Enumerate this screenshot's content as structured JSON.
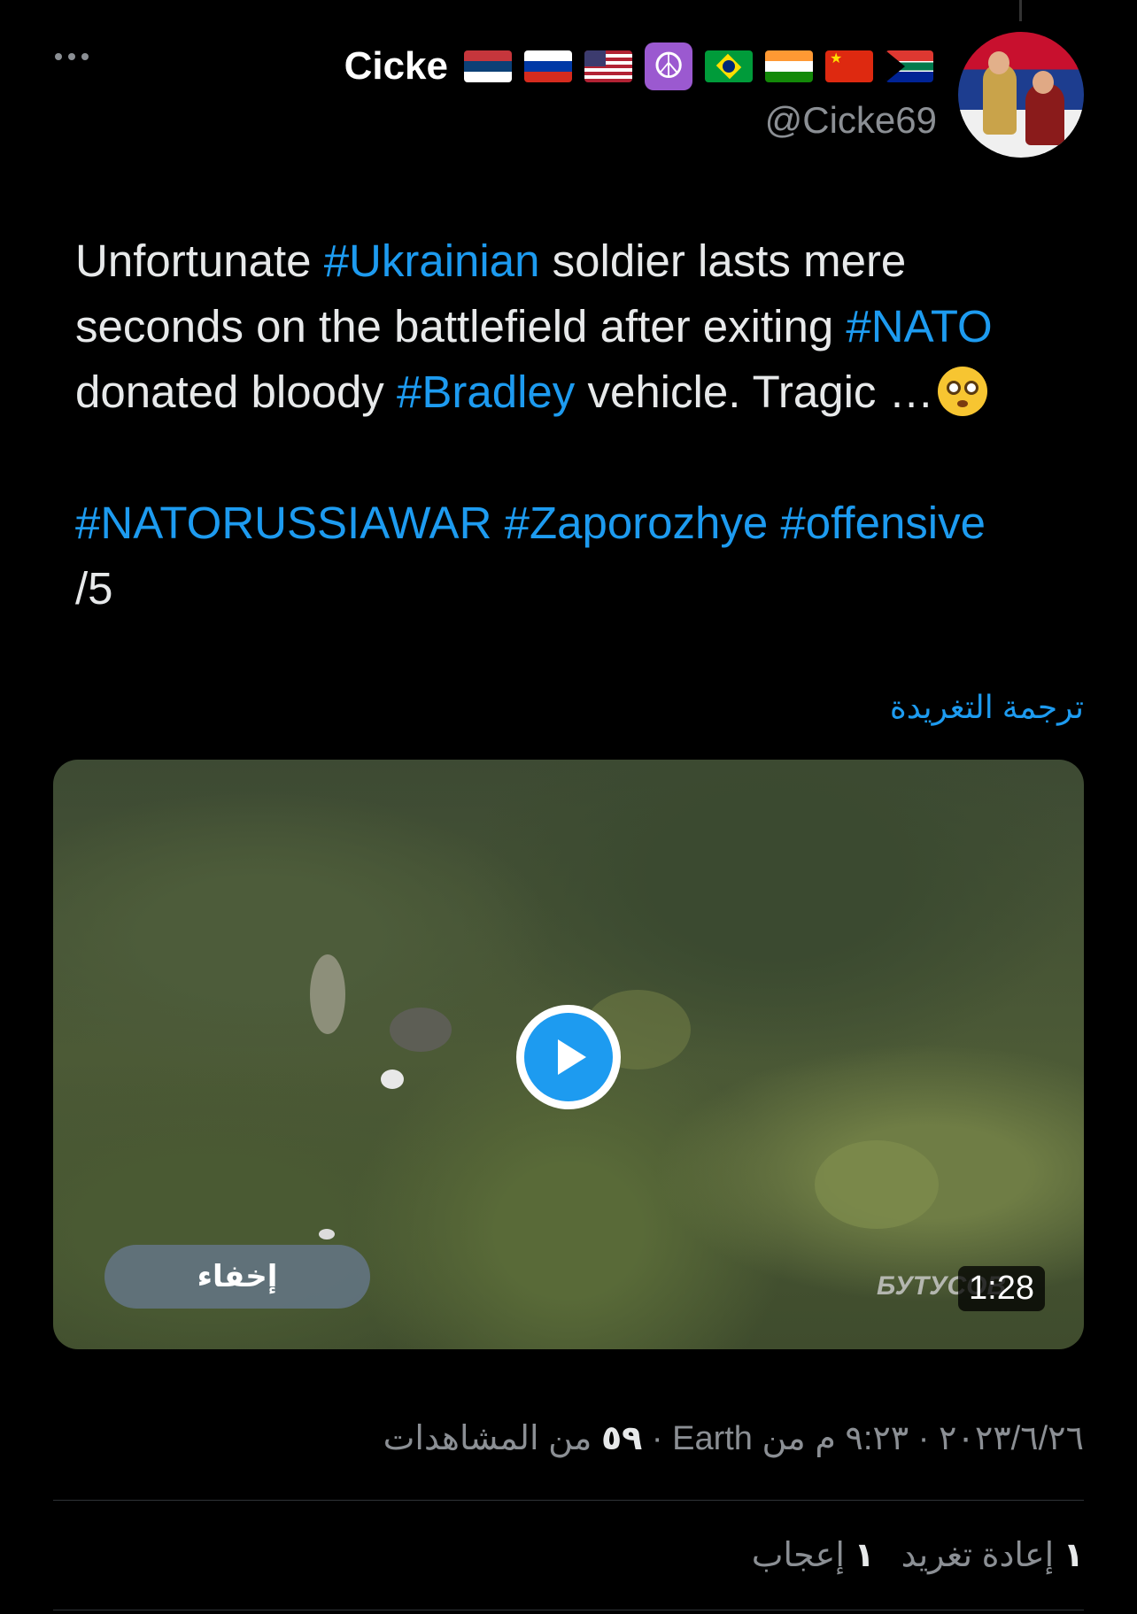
{
  "header": {
    "more_label": "•••",
    "display_name": "Cicke",
    "handle": "@Cicke69",
    "flags": [
      "serbia-flag",
      "russia-flag",
      "usa-flag",
      "peace-icon",
      "brazil-flag",
      "india-flag",
      "china-flag",
      "south-africa-flag"
    ]
  },
  "tweet": {
    "line1_a": "Unfortunate ",
    "tag_ukrainian": "#Ukrainian",
    "line1_b": " soldier lasts mere seconds on the battlefield after exiting ",
    "tag_nato": "#NATO",
    "line2_a": " donated bloody ",
    "tag_bradley": "#Bradley",
    "line2_b": " vehicle. Tragic …",
    "tag_natorussiawar": "#NATORUSSIAWAR",
    "tag_zaporozhye": "#Zaporozhye",
    "tag_offensive": "#offensive",
    "thread_index": "/5",
    "translate_label": "ترجمة التغريدة"
  },
  "media": {
    "hide_label": "إخفاء",
    "watermark": "БУТУСОВ",
    "duration": "1:28"
  },
  "meta": {
    "timestamp": "٢٠٢٣/٦/٢٦ · ٩:٢٣ م من Earth · ",
    "views_count": "٥٩",
    "views_label": " من المشاهدات"
  },
  "stats": {
    "retweets_count": "١",
    "retweets_label": " إعادة تغريد",
    "likes_count": "١",
    "likes_label": " إعجاب"
  },
  "colors": {
    "accent": "#1d9bf0",
    "background": "#000000",
    "muted": "#8b8f94"
  }
}
